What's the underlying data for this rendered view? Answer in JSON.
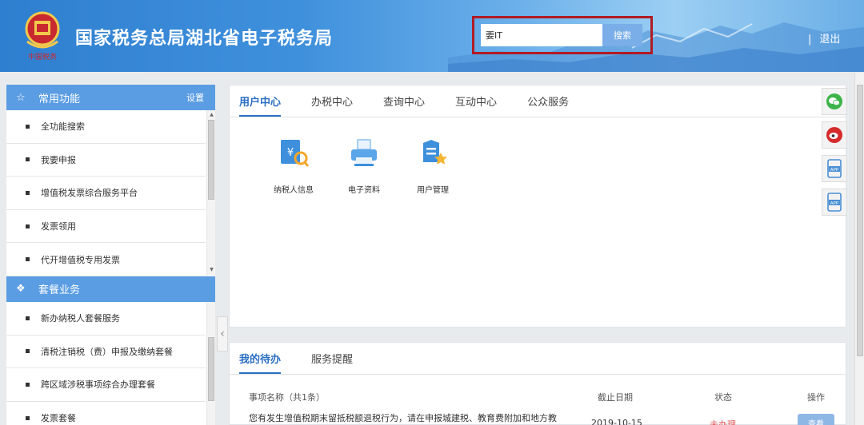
{
  "header": {
    "title": "国家税务总局湖北省电子税务局",
    "emblem_text": "中国税务",
    "search_value": "要IT",
    "search_label": "搜索",
    "separator": "|",
    "logout_label": "退出"
  },
  "sidebar": {
    "section1": {
      "label": "常用功能",
      "settings_label": "设置",
      "icon": "star-icon"
    },
    "section1_items": [
      "全功能搜索",
      "我要申报",
      "增值税发票综合服务平台",
      "发票领用",
      "代开增值税专用发票"
    ],
    "section2": {
      "label": "套餐业务",
      "icon": "layers-icon"
    },
    "section2_items": [
      "新办纳税人套餐服务",
      "清税注销税（费）申报及缴纳套餐",
      "跨区域涉税事项综合办理套餐",
      "发票套餐"
    ]
  },
  "main": {
    "tabs": [
      "用户中心",
      "办税中心",
      "查询中心",
      "互动中心",
      "公众服务"
    ],
    "tiles": [
      {
        "label": "纳税人信息",
        "icon": "taxpayer-info-icon"
      },
      {
        "label": "电子资料",
        "icon": "printer-icon"
      },
      {
        "label": "用户管理",
        "icon": "user-manage-icon"
      }
    ]
  },
  "todo": {
    "tabs": [
      "我的待办",
      "服务提醒"
    ],
    "columns": {
      "name": "事项名称（共1条）",
      "deadline": "截止日期",
      "status": "状态",
      "action": "操作"
    },
    "rows": [
      {
        "name": "您有发生增值税期末留抵税额退税行为，请在申报城建税、教育费附加和地方教",
        "deadline": "2019-10-15",
        "status": "未办理",
        "action": "查看"
      }
    ]
  },
  "float_icons": [
    "wechat-icon",
    "weibo-icon",
    "app-icon",
    "app-icon"
  ],
  "float_icon_text": "APP",
  "colors": {
    "header_blue": "#2f7fd0",
    "accent": "#5b9de3",
    "tab_active": "#2b6fc2",
    "highlight_red": "#b01b24"
  }
}
